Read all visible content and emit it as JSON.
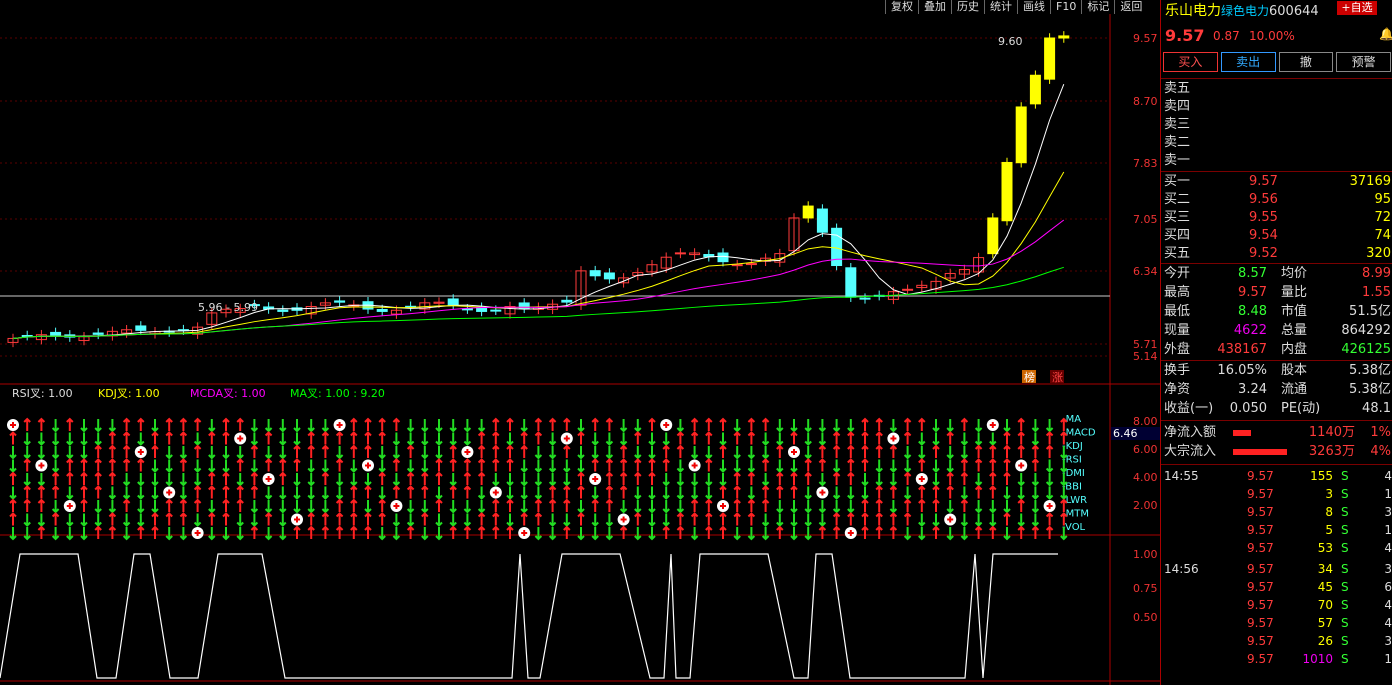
{
  "toolbar": [
    "复权",
    "叠加",
    "历史",
    "统计",
    "画线",
    "F10",
    "标记",
    "返回"
  ],
  "main_chart": {
    "price_axis": [
      "9.57",
      "8.70",
      "7.83",
      "7.05",
      "6.34",
      "5.71",
      "5.14"
    ],
    "max_label": "9.60",
    "min_label": "5.96 - 5.99",
    "badges": [
      "榜",
      "涨"
    ]
  },
  "indicator_bar": {
    "rsi": "RSI叉: 1.00",
    "kdj": "KDJ叉: 1.00",
    "mcda": "MCDA叉: 1.00",
    "ma": "MA叉: 1.00 : 9.20"
  },
  "signal_panel": {
    "rows": [
      "MA",
      "MACD",
      "KDJ",
      "RSI",
      "DMI",
      "BBI",
      "LWR",
      "MTM",
      "VOL"
    ],
    "axis": [
      "8.00",
      "6.00",
      "4.00",
      "2.00"
    ],
    "current": "6.46"
  },
  "bottom_panel": {
    "axis": [
      "1.00",
      "0.75",
      "0.50"
    ]
  },
  "quote": {
    "name": "乐山电力",
    "sub": "绿色电力",
    "code": "600644",
    "add_label": "+自选",
    "price": "9.57",
    "change": "0.87",
    "pct": "10.00%",
    "buttons": [
      "买入",
      "卖出",
      "撤",
      "预警"
    ],
    "asks": [
      "卖五",
      "卖四",
      "卖三",
      "卖二",
      "卖一"
    ],
    "bids": [
      {
        "label": "买一",
        "price": "9.57",
        "vol": "37169"
      },
      {
        "label": "买二",
        "price": "9.56",
        "vol": "95"
      },
      {
        "label": "买三",
        "price": "9.55",
        "vol": "72"
      },
      {
        "label": "买四",
        "price": "9.54",
        "vol": "74"
      },
      {
        "label": "买五",
        "price": "9.52",
        "vol": "320"
      }
    ],
    "stats": [
      {
        "l1": "今开",
        "v1": "8.57",
        "c1": "green",
        "l2": "均价",
        "v2": "8.99",
        "c2": "red"
      },
      {
        "l1": "最高",
        "v1": "9.57",
        "c1": "red",
        "l2": "量比",
        "v2": "1.55",
        "c2": "red"
      },
      {
        "l1": "最低",
        "v1": "8.48",
        "c1": "green",
        "l2": "市值",
        "v2": "51.5亿",
        "c2": "white"
      },
      {
        "l1": "现量",
        "v1": "4622",
        "c1": "magenta",
        "l2": "总量",
        "v2": "864292",
        "c2": "white"
      },
      {
        "l1": "外盘",
        "v1": "438167",
        "c1": "red",
        "l2": "内盘",
        "v2": "426125",
        "c2": "green"
      }
    ],
    "stats2": [
      {
        "l1": "换手",
        "v1": "16.05%",
        "l2": "股本",
        "v2": "5.38亿"
      },
      {
        "l1": "净资",
        "v1": "3.24",
        "l2": "流通",
        "v2": "5.38亿"
      },
      {
        "l1": "收益(一)",
        "v1": "0.050",
        "l2": "PE(动)",
        "v2": "48.1"
      }
    ],
    "flows": [
      {
        "label": "净流入额",
        "value": "1140万",
        "pct": "1%"
      },
      {
        "label": "大宗流入",
        "value": "3263万",
        "pct": "4%"
      }
    ],
    "ticks": [
      {
        "time": "14:55",
        "price": "9.57",
        "vol": "155",
        "side": "S",
        "n": "4"
      },
      {
        "time": "",
        "price": "9.57",
        "vol": "3",
        "side": "S",
        "n": "1"
      },
      {
        "time": "",
        "price": "9.57",
        "vol": "8",
        "side": "S",
        "n": "3"
      },
      {
        "time": "",
        "price": "9.57",
        "vol": "5",
        "side": "S",
        "n": "1"
      },
      {
        "time": "",
        "price": "9.57",
        "vol": "53",
        "side": "S",
        "n": "4"
      },
      {
        "time": "14:56",
        "price": "9.57",
        "vol": "34",
        "side": "S",
        "n": "3"
      },
      {
        "time": "",
        "price": "9.57",
        "vol": "45",
        "side": "S",
        "n": "6"
      },
      {
        "time": "",
        "price": "9.57",
        "vol": "70",
        "side": "S",
        "n": "4"
      },
      {
        "time": "",
        "price": "9.57",
        "vol": "57",
        "side": "S",
        "n": "4"
      },
      {
        "time": "",
        "price": "9.57",
        "vol": "26",
        "side": "S",
        "n": "3"
      },
      {
        "time": "",
        "price": "9.57",
        "vol": "1010",
        "side": "S",
        "n": "1"
      }
    ]
  }
}
